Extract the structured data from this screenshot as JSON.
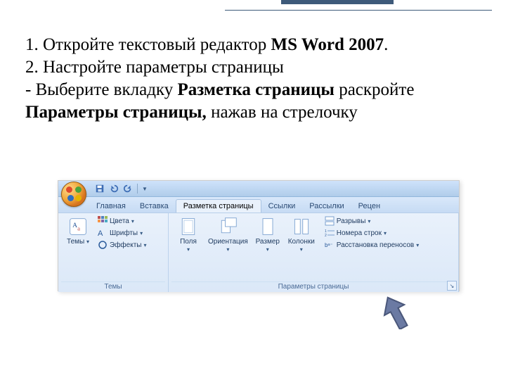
{
  "instructions": {
    "line1_pre": "1. Откройте текстовый редактор ",
    "line1_bold": "MS Word 2007",
    "line1_post": ".",
    "line2": "2. Настройте параметры страницы",
    "line3_pre": "- Выберите вкладку ",
    "line3_b1": "Разметка страницы",
    "line3_mid": " раскройте ",
    "line3_b2": "Параметры страницы,",
    "line3_post": " нажав на стрелочку"
  },
  "ribbon": {
    "tabs": [
      "Главная",
      "Вставка",
      "Разметка страницы",
      "Ссылки",
      "Рассылки",
      "Рецен"
    ],
    "active_tab_index": 2,
    "groups": {
      "themes": {
        "title": "Темы",
        "big": "Темы",
        "items": [
          "Цвета",
          "Шрифты",
          "Эффекты"
        ]
      },
      "pagesetup": {
        "title": "Параметры страницы",
        "big": [
          "Поля",
          "Ориентация",
          "Размер",
          "Колонки"
        ],
        "side": [
          "Разрывы",
          "Номера строк",
          "Расстановка переносов"
        ]
      }
    }
  }
}
